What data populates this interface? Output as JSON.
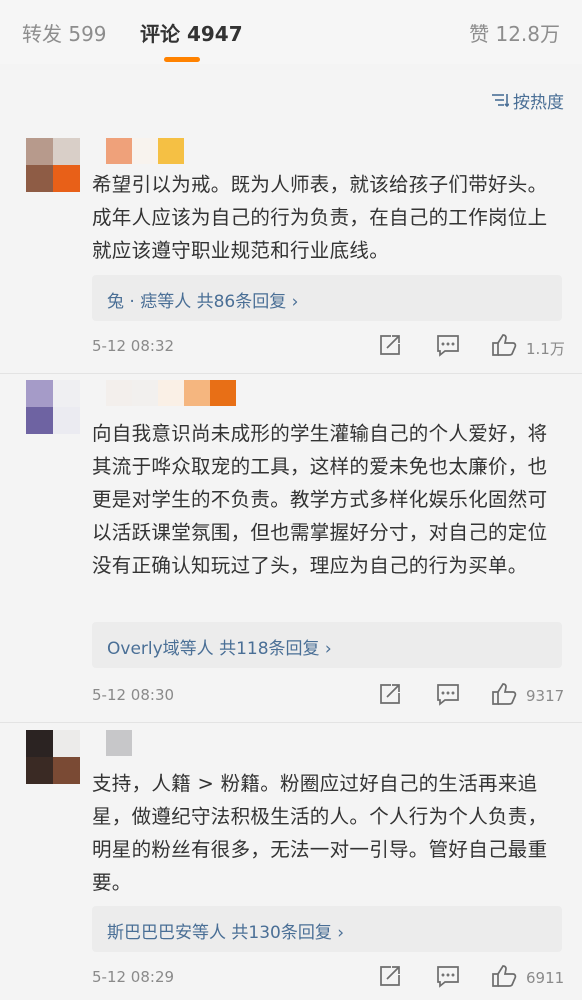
{
  "tabs": {
    "repost": "转发 599",
    "comment": "评论 4947",
    "like": "赞 12.8万"
  },
  "sort": {
    "label": "按热度"
  },
  "comments": [
    {
      "text": "希望引以为戒。既为人师表，就该给孩子们带好头。成年人应该为自己的行为负责，在自己的工作岗位上就应该遵守职业规范和行业底线。",
      "replies": "兔 · 痣等人  共86条回复 ›",
      "time": "5-12 08:32",
      "likes": "1.1万"
    },
    {
      "text": "向自我意识尚未成形的学生灌输自己的个人爱好，将其流于哗众取宠的工具，这样的爱未免也太廉价，也更是对学生的不负责。教学方式多样化娱乐化固然可以活跃课堂氛围，但也需掌握好分寸，对自己的定位没有正确认知玩过了头，理应为自己的行为买单。",
      "replies": "Overly域等人  共118条回复 ›",
      "time": "5-12 08:30",
      "likes": "9317"
    },
    {
      "text": "支持，人籍 > 粉籍。粉圈应过好自己的生活再来追星，做遵纪守法积极生活的人。个人行为个人负责，明星的粉丝有很多，无法一对一引导。管好自己最重要。",
      "replies": "斯巴巴巴安等人  共130条回复 ›",
      "time": "5-12 08:29",
      "likes": "6911"
    }
  ]
}
